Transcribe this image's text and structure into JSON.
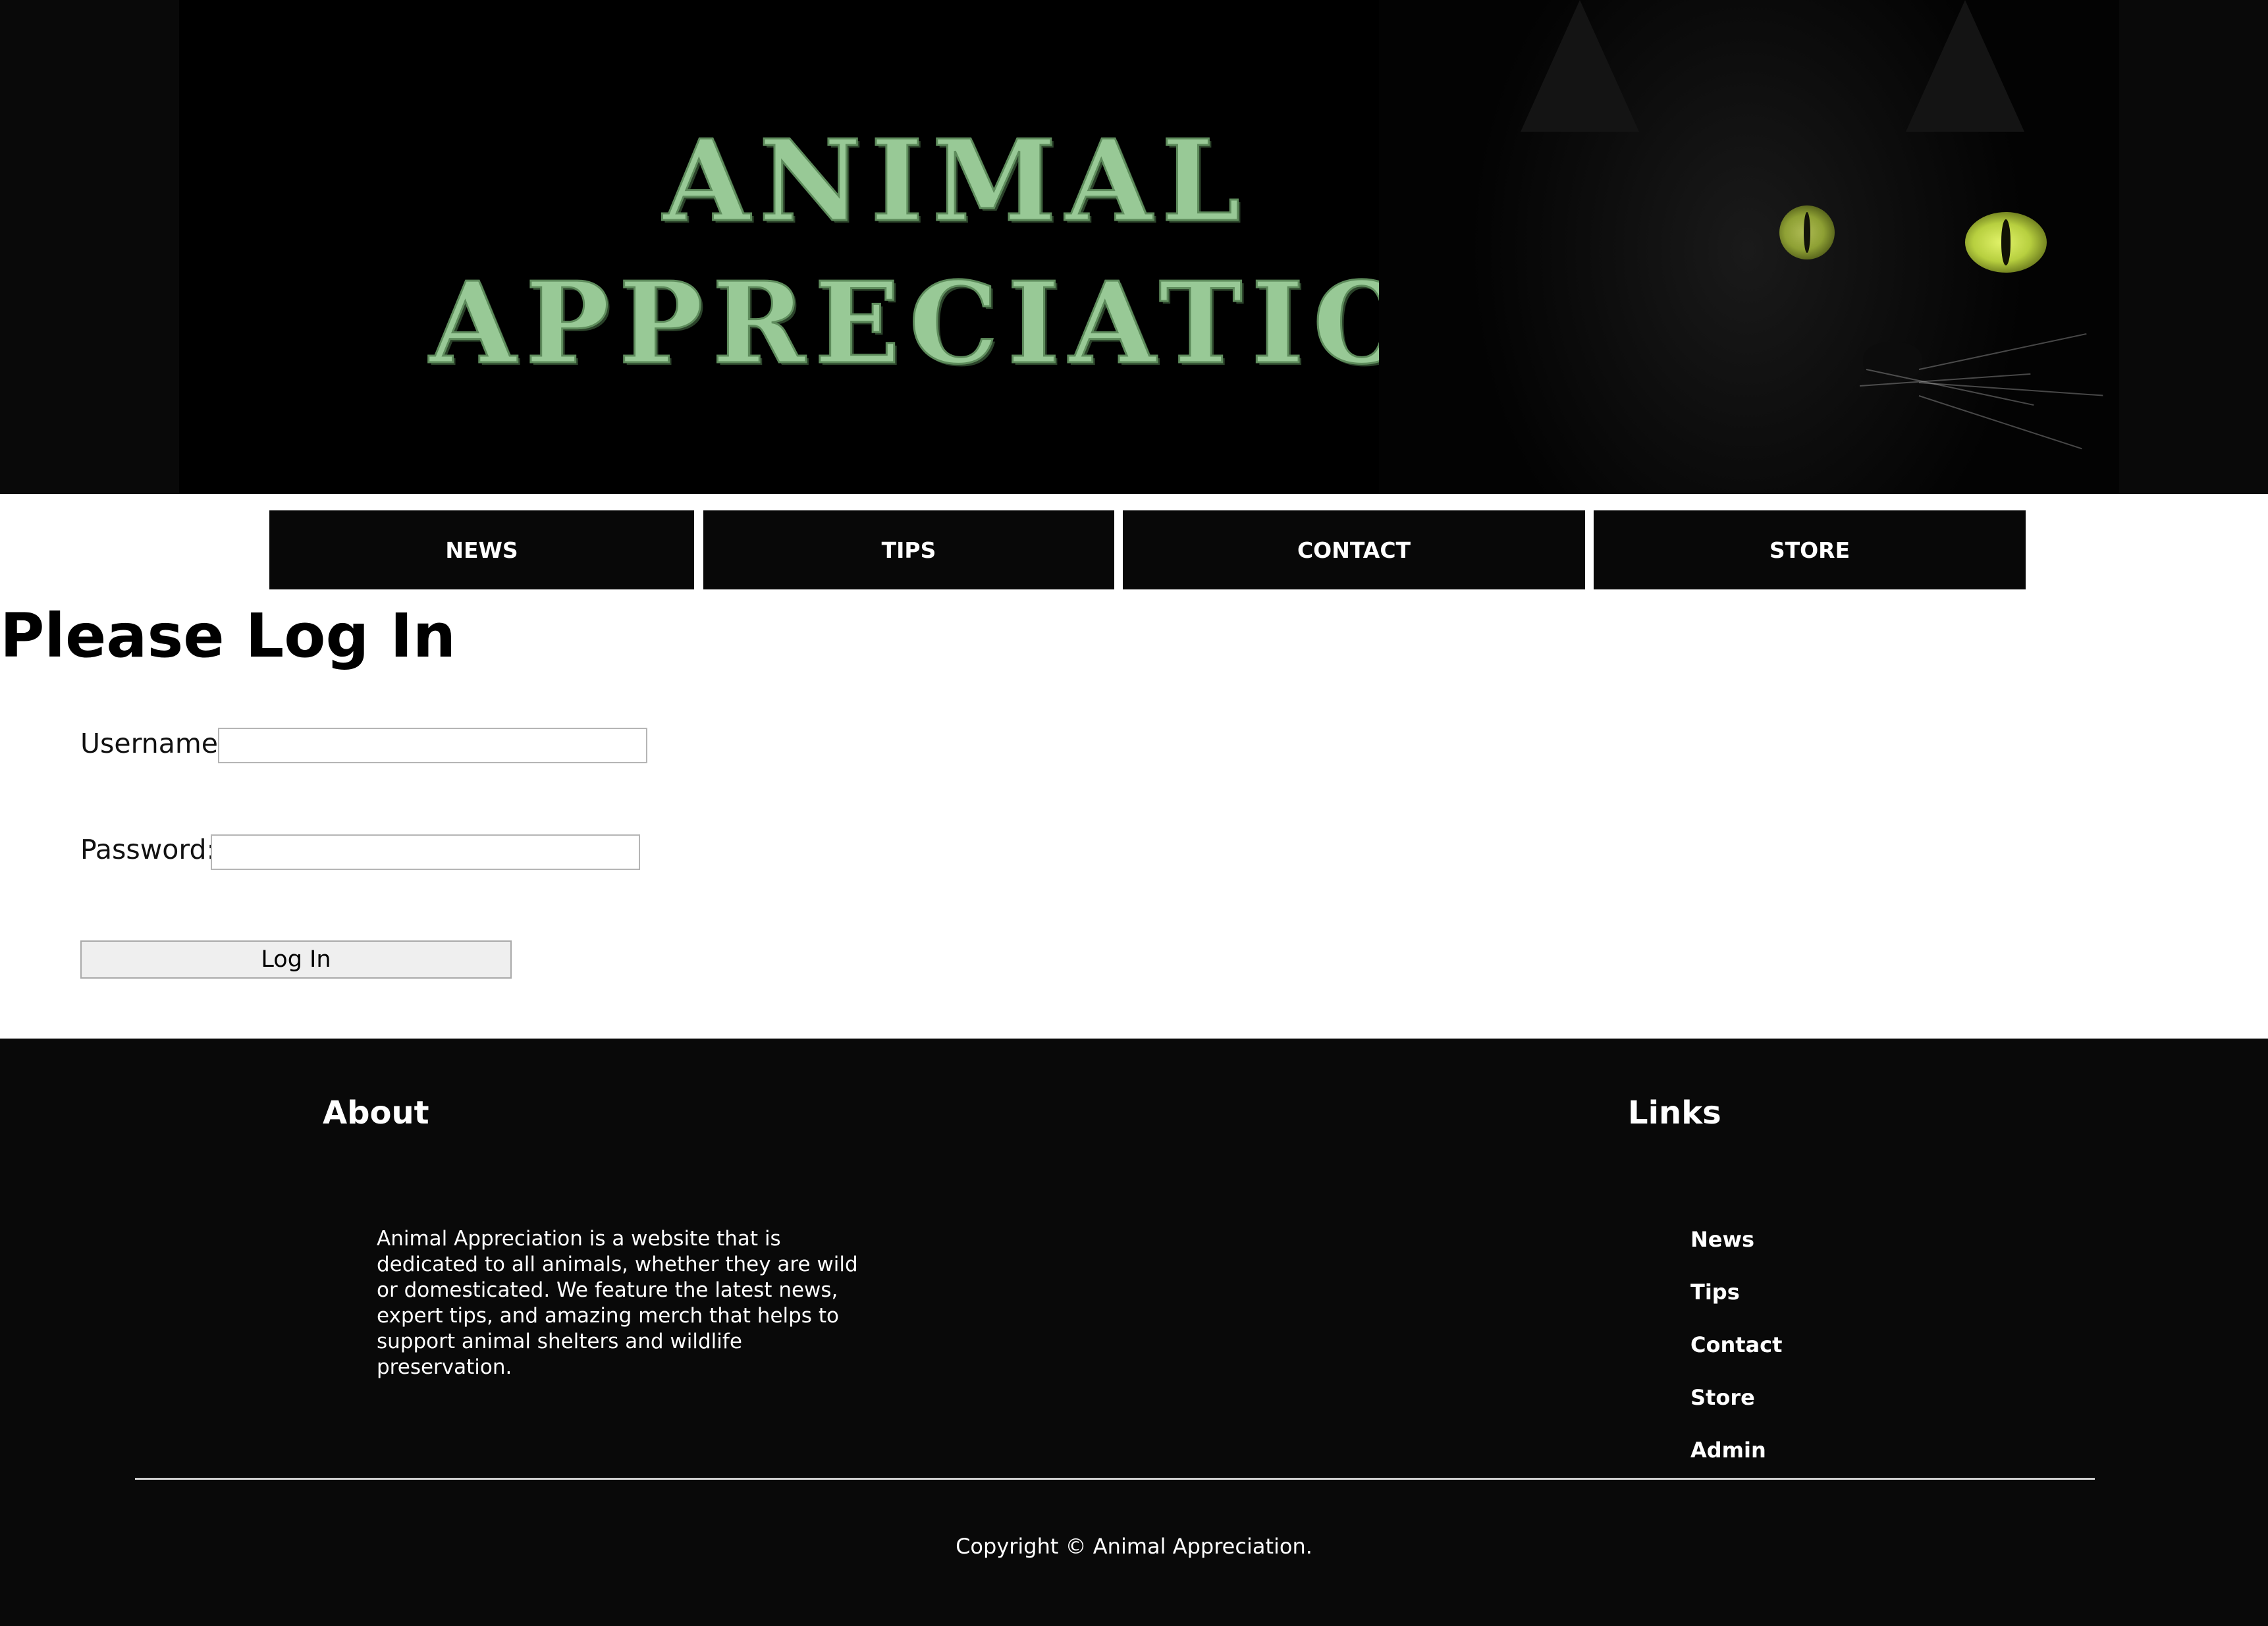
{
  "header": {
    "logo_line1": "ANIMAL",
    "logo_line2": "APPRECIATION",
    "logo_color": "#98c996",
    "banner_image": "black-cat-green-eyes"
  },
  "nav": {
    "items": [
      {
        "label": "NEWS"
      },
      {
        "label": "TIPS"
      },
      {
        "label": "CONTACT"
      },
      {
        "label": "STORE"
      }
    ]
  },
  "main": {
    "title": "Please Log In",
    "username_label": "Username:",
    "username_value": "",
    "password_label": "Password:",
    "password_value": "",
    "submit_label": "Log In"
  },
  "footer": {
    "about_heading": "About",
    "about_text": "Animal Appreciation is a website that is dedicated to all animals, whether they are wild or domesticated. We feature the latest news, expert tips, and amazing merch that helps to support animal shelters and wildlife preservation.",
    "links_heading": "Links",
    "links": [
      {
        "label": "News"
      },
      {
        "label": "Tips"
      },
      {
        "label": "Contact"
      },
      {
        "label": "Store"
      },
      {
        "label": "Admin"
      }
    ],
    "copyright": "Copyright © Animal Appreciation."
  },
  "colors": {
    "dark_background": "#090909",
    "nav_background": "#080808",
    "page_background": "#ffffff"
  }
}
